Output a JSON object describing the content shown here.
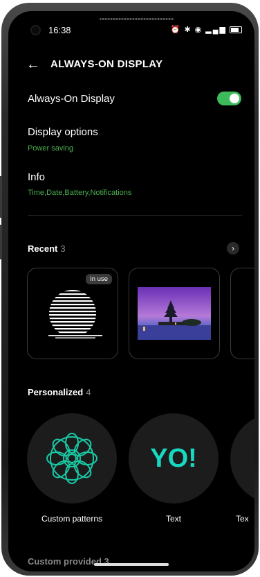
{
  "status": {
    "time": "16:38",
    "icons": [
      "alarm-icon",
      "bluetooth-icon",
      "wifi-icon",
      "signal-icon",
      "battery-icon"
    ]
  },
  "header": {
    "title": "ALWAYS-ON DISPLAY"
  },
  "aod_toggle": {
    "label": "Always-On Display",
    "on": true
  },
  "display_options": {
    "label": "Display options",
    "value": "Power saving"
  },
  "info": {
    "label": "Info",
    "value": "Time,Date,Battery,Notifications"
  },
  "recent": {
    "label": "Recent",
    "count": "3",
    "badge": "In use"
  },
  "personalized": {
    "label": "Personalized",
    "count": "4",
    "items": [
      {
        "label": "Custom patterns"
      },
      {
        "label": "Text",
        "preview": "YO!"
      },
      {
        "label": "Tex"
      }
    ]
  },
  "bottom_section": {
    "label": "Custom provided 3"
  },
  "colors": {
    "accent": "#3dbb5a",
    "accent_text": "#4caf50",
    "yo": "#17d8c0"
  }
}
